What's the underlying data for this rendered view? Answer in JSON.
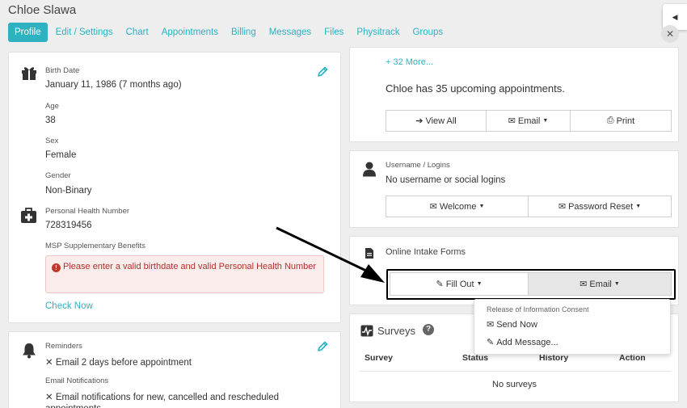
{
  "patient": {
    "name": "Chloe Slawa"
  },
  "tabs": [
    {
      "label": "Profile"
    },
    {
      "label": "Edit / Settings"
    },
    {
      "label": "Chart"
    },
    {
      "label": "Appointments"
    },
    {
      "label": "Billing"
    },
    {
      "label": "Messages"
    },
    {
      "label": "Files"
    },
    {
      "label": "Physitrack"
    },
    {
      "label": "Groups"
    }
  ],
  "side_toggle": {
    "glyph": "◀"
  },
  "close_glyph": "✕",
  "demographics": {
    "birth_date_label": "Birth Date",
    "birth_date_value": "January 11, 1986 (7 months ago)",
    "age_label": "Age",
    "age_value": "38",
    "sex_label": "Sex",
    "sex_value": "Female",
    "gender_label": "Gender",
    "gender_value": "Non-Binary",
    "phn_label": "Personal Health Number",
    "phn_value": "728319456",
    "msp_label": "MSP Supplementary Benefits",
    "msp_alert": "Please enter a valid birthdate and valid Personal Health Number",
    "check_now": "Check Now"
  },
  "reminders": {
    "label": "Reminders",
    "reminder_value": "✕ Email 2 days before appointment",
    "email_notifications_label": "Email Notifications",
    "email_notifications_value": "✕ Email notifications for new, cancelled and rescheduled",
    "email_notifications_value_2": "appointments"
  },
  "appointments": {
    "more_link": "+ 32 More...",
    "upcoming_text": "Chloe has 35 upcoming appointments.",
    "view_all": "View All",
    "email": "Email",
    "print": "Print"
  },
  "logins": {
    "label": "Username / Logins",
    "value": "No username or social logins",
    "welcome": "Welcome",
    "password_reset": "Password Reset"
  },
  "intake": {
    "label": "Online Intake Forms",
    "fill_out": "Fill Out",
    "email": "Email"
  },
  "dropdown": {
    "header": "Release of Information Consent",
    "send_now": "Send Now",
    "add_message": "Add Message..."
  },
  "surveys": {
    "title": "Surveys",
    "help_glyph": "?",
    "columns": [
      "Survey",
      "Status",
      "History",
      "Action"
    ],
    "empty": "No surveys"
  },
  "colors": {
    "accent": "#2cb2c1",
    "alert_text": "#b0302b",
    "alert_bg": "#fbecec"
  }
}
